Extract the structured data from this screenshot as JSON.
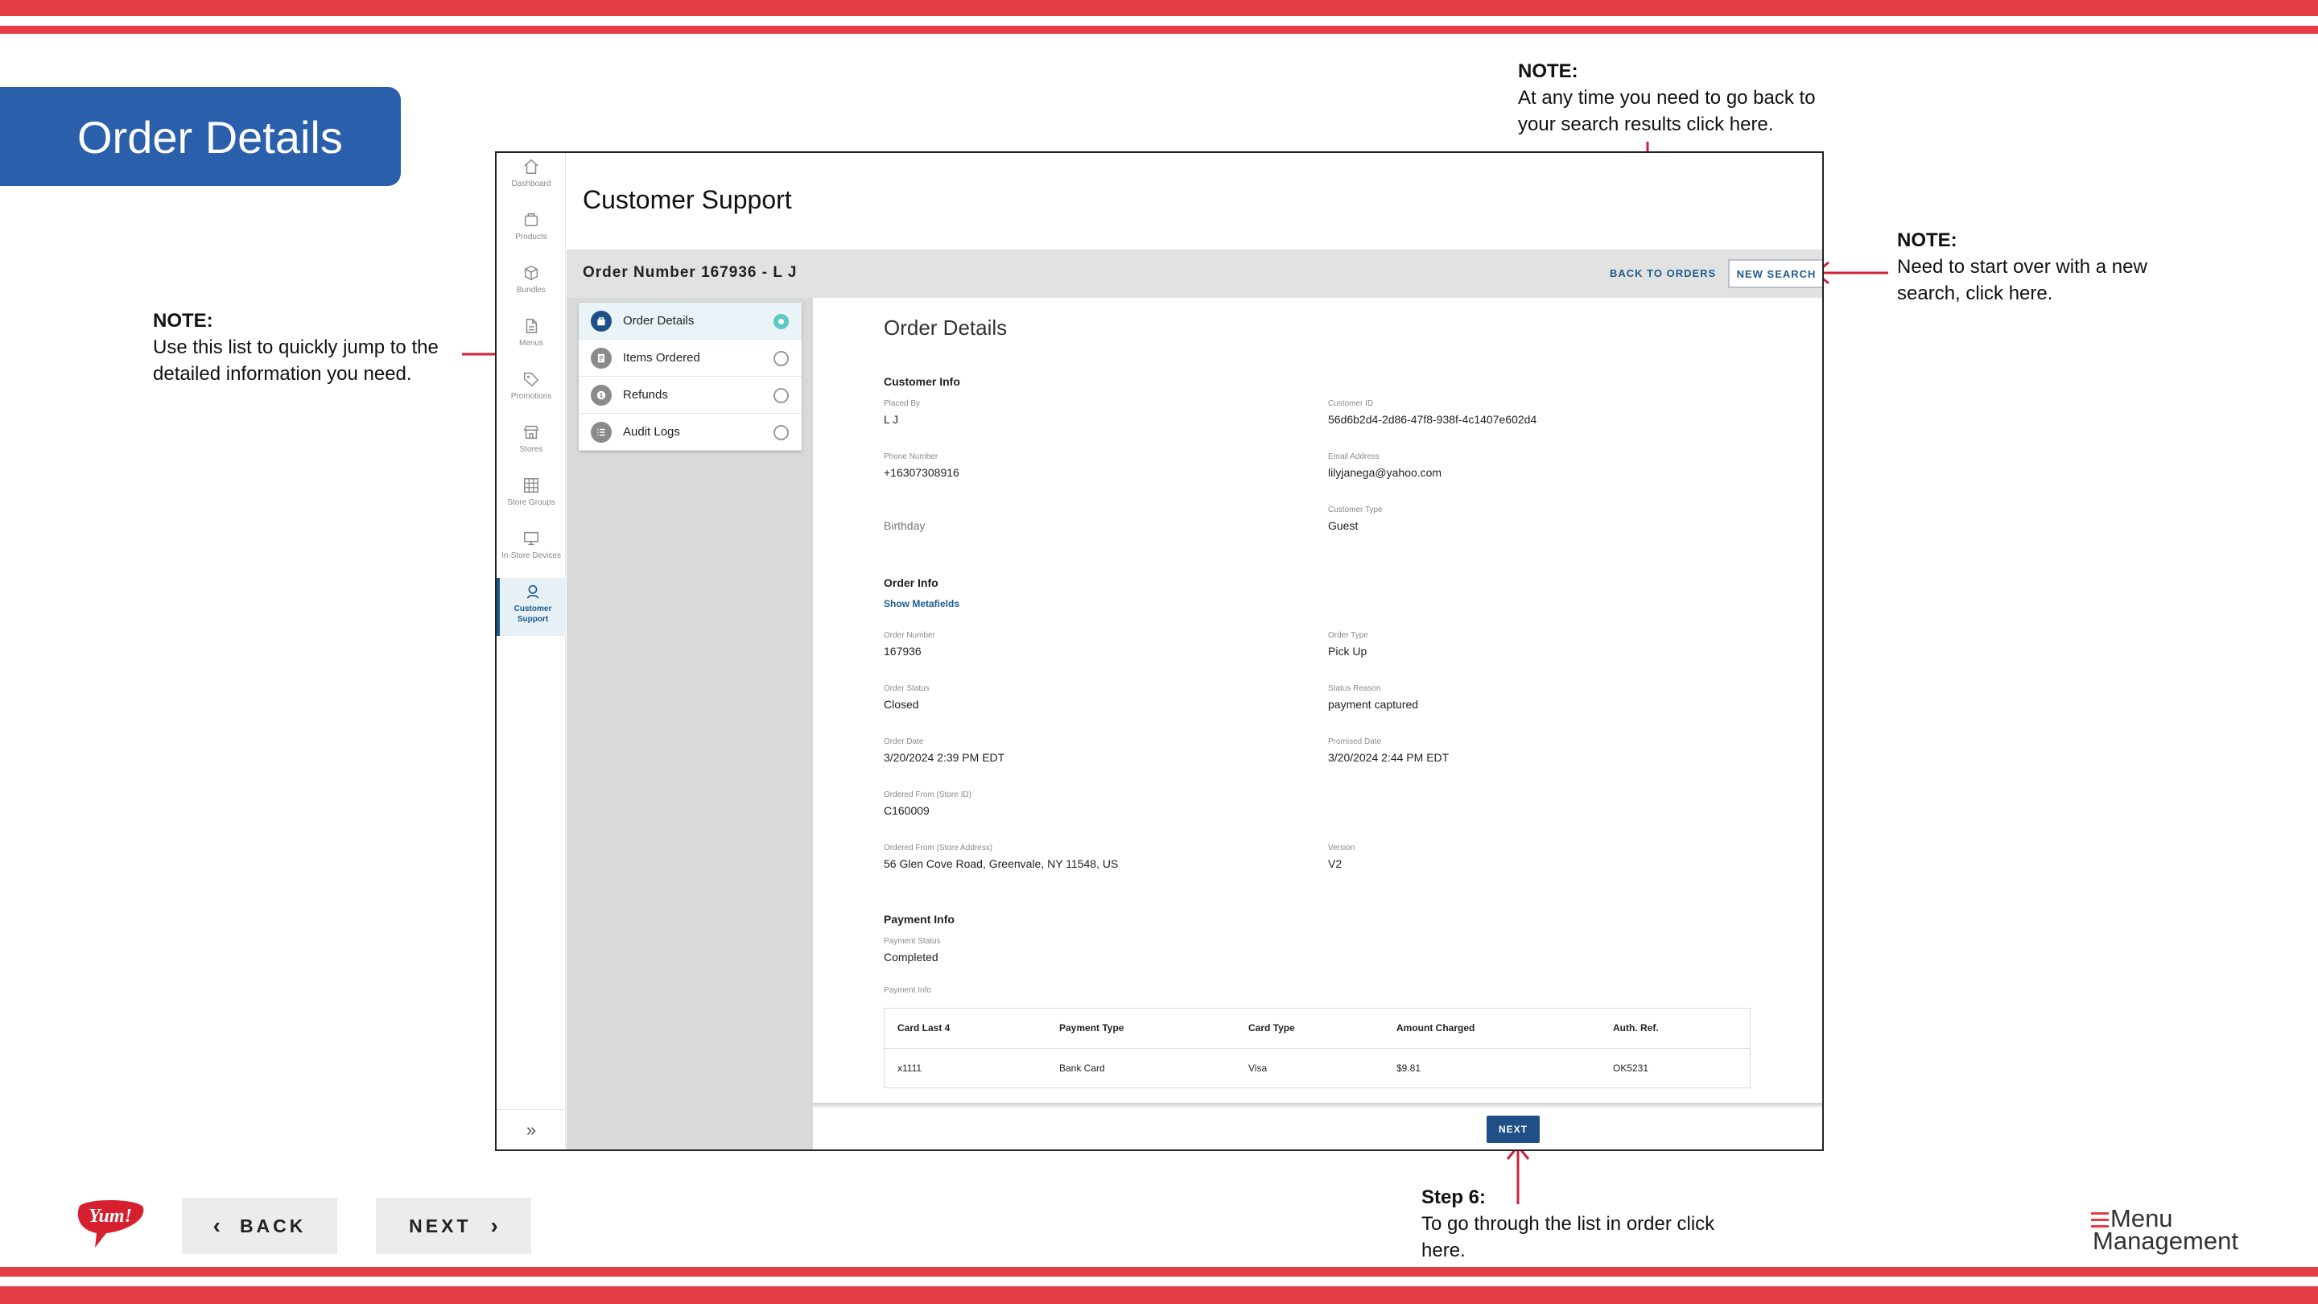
{
  "slide": {
    "title": "Order Details",
    "colors": {
      "accent_red": "#e63c46",
      "title_blue": "#2a5fab",
      "app_blue": "#1f4f86"
    }
  },
  "notes": {
    "left": {
      "heading": "NOTE:",
      "text": "Use this list to quickly jump to the detailed information you need."
    },
    "top": {
      "heading": "NOTE:",
      "text": "At any time you need to go back to your search results click here."
    },
    "right": {
      "heading": "NOTE:",
      "text": "Need to start over with a new search, click here."
    },
    "step": {
      "heading": "Step 6:",
      "text": "To go through the list in order click here."
    }
  },
  "nav": {
    "back_label": "BACK",
    "next_label": "NEXT"
  },
  "logos": {
    "yum": "Yum!",
    "menu_management_line1": "Menu",
    "menu_management_line2": "Management"
  },
  "app": {
    "title": "Customer Support",
    "sidebar": [
      {
        "label": "Dashboard",
        "icon": "home-icon"
      },
      {
        "label": "Products",
        "icon": "box-icon"
      },
      {
        "label": "Bundles",
        "icon": "cube-icon"
      },
      {
        "label": "Menus",
        "icon": "document-icon"
      },
      {
        "label": "Promotions",
        "icon": "tag-icon"
      },
      {
        "label": "Stores",
        "icon": "store-icon"
      },
      {
        "label": "Store Groups",
        "icon": "grid-icon"
      },
      {
        "label": "In-Store Devices",
        "icon": "monitor-icon"
      },
      {
        "label": "Customer Support",
        "icon": "support-icon",
        "active": true
      }
    ],
    "order_bar": {
      "order_number": "Order Number 167936 - L J",
      "back_to_orders": "BACK TO ORDERS",
      "new_search": "NEW SEARCH"
    },
    "jump_list": [
      {
        "label": "Order Details",
        "active": true
      },
      {
        "label": "Items Ordered",
        "active": false
      },
      {
        "label": "Refunds",
        "active": false
      },
      {
        "label": "Audit Logs",
        "active": false
      }
    ],
    "details": {
      "title": "Order Details",
      "customer_info": {
        "heading": "Customer Info",
        "placed_by_label": "Placed By",
        "placed_by": "L J",
        "customer_id_label": "Customer ID",
        "customer_id": "56d6b2d4-2d86-47f8-938f-4c1407e602d4",
        "phone_label": "Phone Number",
        "phone": "+16307308916",
        "email_label": "Email Address",
        "email": "lilyjanega@yahoo.com",
        "birthday": "Birthday",
        "customer_type_label": "Customer Type",
        "customer_type": "Guest"
      },
      "order_info": {
        "heading": "Order Info",
        "show_metafields": "Show Metafields",
        "order_number_label": "Order Number",
        "order_number": "167936",
        "order_type_label": "Order Type",
        "order_type": "Pick Up",
        "order_status_label": "Order Status",
        "order_status": "Closed",
        "status_reason_label": "Status Reason",
        "status_reason": "payment captured",
        "order_date_label": "Order Date",
        "order_date": "3/20/2024 2:39 PM EDT",
        "promised_date_label": "Promised Date",
        "promised_date": "3/20/2024 2:44 PM EDT",
        "store_id_label": "Ordered From (Store ID)",
        "store_id": "C160009",
        "store_address_label": "Ordered From (Store Address)",
        "store_address": "56 Glen Cove Road, Greenvale, NY 11548, US",
        "version_label": "Version",
        "version": "V2"
      },
      "payment_info": {
        "heading": "Payment Info",
        "status_label": "Payment Status",
        "status": "Completed",
        "info_label": "Payment Info",
        "columns": [
          "Card Last 4",
          "Payment Type",
          "Card Type",
          "Amount Charged",
          "Auth. Ref."
        ],
        "rows": [
          [
            "x1111",
            "Bank Card",
            "Visa",
            "$9.81",
            "OK5231"
          ]
        ]
      }
    },
    "next_button": "NEXT"
  }
}
